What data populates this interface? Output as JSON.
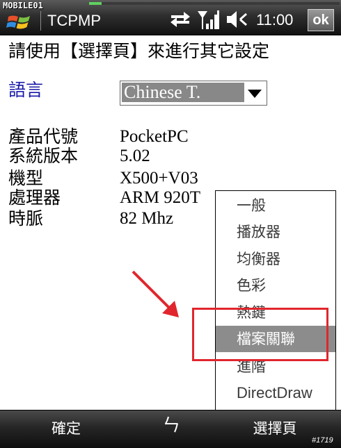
{
  "watermark": "MOBILE01",
  "status": {
    "app_title": "TCPMP",
    "clock": "11:00",
    "ok_label": "ok",
    "progress": 0.05,
    "icons": [
      "windows-start-icon",
      "sync-arrows-icon",
      "signal-icon",
      "volume-icon"
    ]
  },
  "content": {
    "heading": "請使用【選擇頁】來進行其它設定",
    "language_label": "語言",
    "language_value": "Chinese T.",
    "info": [
      {
        "label": "產品代號",
        "value": "PocketPC"
      },
      {
        "label": "系統版本",
        "value": "5.02"
      },
      {
        "label": "機型",
        "value": "X500+V03"
      },
      {
        "label": "處理器",
        "value": "ARM 920T"
      },
      {
        "label": "時脈",
        "value": "82 Mhz"
      }
    ]
  },
  "menu": {
    "items": [
      {
        "label": "一般"
      },
      {
        "label": "播放器"
      },
      {
        "label": "均衡器"
      },
      {
        "label": "色彩"
      },
      {
        "label": "熱鍵"
      },
      {
        "label": "檔案關聯"
      },
      {
        "label": "進階"
      },
      {
        "label": "DirectDraw"
      }
    ],
    "selected_index": 5
  },
  "softkeys": {
    "left": "確定",
    "middle": "ㄣ",
    "right": "選擇頁"
  },
  "image_id": "#1719",
  "colors": {
    "highlight_box": "#e0262c",
    "arrow": "#e0262c",
    "language_label": "#1a1aa8",
    "menu_selected": "#8c8c8c"
  }
}
